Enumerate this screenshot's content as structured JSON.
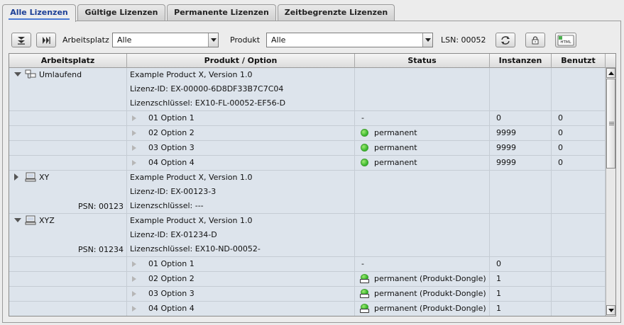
{
  "tabs": [
    {
      "label": "Alle Lizenzen",
      "active": true
    },
    {
      "label": "Gültige Lizenzen",
      "active": false
    },
    {
      "label": "Permanente Lizenzen",
      "active": false
    },
    {
      "label": "Zeitbegrenzte Lizenzen",
      "active": false
    }
  ],
  "toolbar": {
    "workstation_label": "Arbeitsplatz",
    "workstation_value": "Alle",
    "product_label": "Produkt",
    "product_value": "Alle",
    "lsn": "LSN: 00052",
    "icons": [
      "collapse-all-icon",
      "expand-all-icon",
      "refresh-icon",
      "lock-icon",
      "export-html-icon"
    ],
    "export_icon_text": "HTML"
  },
  "columns": [
    "Arbeitsplatz",
    "Produkt / Option",
    "Status",
    "Instanzen",
    "Benutzt"
  ],
  "groups": [
    {
      "workstation": "Umlaufend",
      "expanded": true,
      "psn": "",
      "product": "Example Product X, Version 1.0",
      "license_id": "Lizenz-ID: EX-00000-6D8DF33B7C7C04",
      "license_key": "Lizenzschlüssel: EX10-FL-00052-EF56-D",
      "options": [
        {
          "name": "01 Option 1",
          "status": "-",
          "status_icon": "",
          "instances": "0",
          "used": "0"
        },
        {
          "name": "02 Option 2",
          "status": "permanent",
          "status_icon": "green-dot",
          "instances": "9999",
          "used": "0"
        },
        {
          "name": "03 Option 3",
          "status": "permanent",
          "status_icon": "green-dot",
          "instances": "9999",
          "used": "0"
        },
        {
          "name": "04 Option 4",
          "status": "permanent",
          "status_icon": "green-dot",
          "instances": "9999",
          "used": "0"
        }
      ]
    },
    {
      "workstation": "XY",
      "expanded": false,
      "psn": "PSN: 00123",
      "product": "Example Product X, Version 1.0",
      "license_id": "Lizenz-ID: EX-00123-3",
      "license_key": "Lizenzschlüssel:   ---",
      "options": []
    },
    {
      "workstation": "XYZ",
      "expanded": true,
      "psn": "PSN: 01234",
      "product": "Example Product X, Version 1.0",
      "license_id": "Lizenz-ID: EX-01234-D",
      "license_key": "Lizenzschlüssel: EX10-ND-00052-",
      "options": [
        {
          "name": "01 Option 1",
          "status": "-",
          "status_icon": "",
          "instances": "0",
          "used": ""
        },
        {
          "name": "02 Option 2",
          "status": "permanent (Produkt-Dongle)",
          "status_icon": "dongle",
          "instances": "1",
          "used": ""
        },
        {
          "name": "03 Option 3",
          "status": "permanent (Produkt-Dongle)",
          "status_icon": "dongle",
          "instances": "1",
          "used": ""
        },
        {
          "name": "04 Option 4",
          "status": "permanent (Produkt-Dongle)",
          "status_icon": "dongle",
          "instances": "1",
          "used": ""
        }
      ]
    }
  ],
  "colors": {
    "accent": "#1c3f96",
    "row_bg": "#dde4ec",
    "status_green": "#35b52b"
  }
}
